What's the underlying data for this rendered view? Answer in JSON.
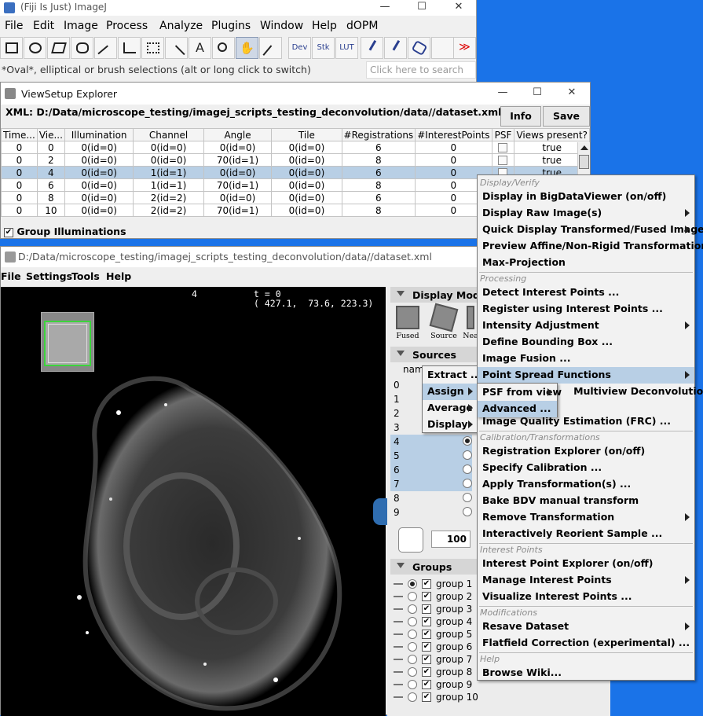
{
  "imagej": {
    "title": "(Fiji Is Just) ImageJ",
    "menu": [
      "File",
      "Edit",
      "Image",
      "Process",
      "Analyze",
      "Plugins",
      "Window",
      "Help",
      "dOPM"
    ],
    "tools": {
      "dev": "Dev",
      "stk": "Stk",
      "lut": "LUT",
      "more": "≫"
    },
    "status": "*Oval*, elliptical or brush selections (alt or long click to switch)",
    "search_placeholder": "Click here to search"
  },
  "viewsetup": {
    "title": "ViewSetup Explorer",
    "xml_path": "XML: D:/Data/microscope_testing/imagej_scripts_testing_deconvolution/data//dataset.xml",
    "info_label": "Info",
    "save_label": "Save",
    "columns": [
      "Time...",
      "Vie...",
      "Illumination",
      "Channel",
      "Angle",
      "Tile",
      "#Registrations",
      "#InterestPoints",
      "PSF",
      "Views present?"
    ],
    "rows": [
      [
        "0",
        "0",
        "0(id=0)",
        "0(id=0)",
        "0(id=0)",
        "0(id=0)",
        "6",
        "0",
        "",
        "true"
      ],
      [
        "0",
        "2",
        "0(id=0)",
        "0(id=0)",
        "70(id=1)",
        "0(id=0)",
        "8",
        "0",
        "",
        "true"
      ],
      [
        "0",
        "4",
        "0(id=0)",
        "1(id=1)",
        "0(id=0)",
        "0(id=0)",
        "6",
        "0",
        "",
        "true"
      ],
      [
        "0",
        "6",
        "0(id=0)",
        "1(id=1)",
        "70(id=1)",
        "0(id=0)",
        "8",
        "0",
        "",
        ""
      ],
      [
        "0",
        "8",
        "0(id=0)",
        "2(id=2)",
        "0(id=0)",
        "0(id=0)",
        "6",
        "0",
        "",
        ""
      ],
      [
        "0",
        "10",
        "0(id=0)",
        "2(id=2)",
        "70(id=1)",
        "0(id=0)",
        "8",
        "0",
        "",
        ""
      ]
    ],
    "group_illuminations": "Group Illuminations"
  },
  "bdv": {
    "title": "D:/Data/microscope_testing/imagej_scripts_testing_deconvolution/data//dataset.xml",
    "menu": [
      "File",
      "Settings",
      "Tools",
      "Help"
    ],
    "overlay": {
      "source_index": "4",
      "time": "t = 0",
      "coords": "( 427.1,  73.6, 223.3)"
    },
    "display_modes_title": "Display Modes",
    "modes": [
      "Fused",
      "Source",
      "Nea"
    ],
    "sources_title": "Sources",
    "sources_col": "nam",
    "sources": [
      "0",
      "1",
      "2",
      "3",
      "4",
      "5",
      "6",
      "7",
      "8",
      "9"
    ],
    "spinner_value": "100",
    "groups_title": "Groups",
    "groups": [
      "group 1",
      "group 2",
      "group 3",
      "group 4",
      "group 5",
      "group 6",
      "group 7",
      "group 8",
      "group 9",
      "group 10"
    ]
  },
  "menus": {
    "sources_menu": [
      "Extract ...",
      "Assign",
      "Average",
      "Display"
    ],
    "main": {
      "display_header": "Display/Verify",
      "display": [
        "Display in BigDataViewer (on/off)",
        "Display Raw Image(s)",
        "Quick Display Transformed/Fused Image(s)",
        "Preview Affine/Non-Rigid Transformations ...",
        "Max-Projection"
      ],
      "processing_header": "Processing",
      "processing": [
        "Detect Interest Points ...",
        "Register using Interest Points ...",
        "Intensity Adjustment",
        "Define Bounding Box ...",
        "Image Fusion ...",
        "Point Spread Functions",
        "Multiview Deconvolution ...",
        "Image Quality Estimation (FRC) ..."
      ],
      "calib_header": "Calibration/Transformations",
      "calib": [
        "Registration Explorer (on/off)",
        "Specify Calibration ...",
        "Apply Transformation(s) ...",
        "Bake BDV manual transform",
        "Remove Transformation",
        "Interactively Reorient Sample ..."
      ],
      "ip_header": "Interest Points",
      "ip": [
        "Interest Point Explorer (on/off)",
        "Manage Interest Points",
        "Visualize Interest Points ..."
      ],
      "mod_header": "Modifications",
      "mod": [
        "Resave Dataset",
        "Flatfield Correction (experimental) ..."
      ],
      "help_header": "Help",
      "help": [
        "Browse Wiki..."
      ]
    },
    "psf_sub": [
      "PSF from view",
      "Advanced ..."
    ]
  },
  "colors": {
    "desktop": "#1a73e8",
    "selection": "#b8cfe5"
  }
}
